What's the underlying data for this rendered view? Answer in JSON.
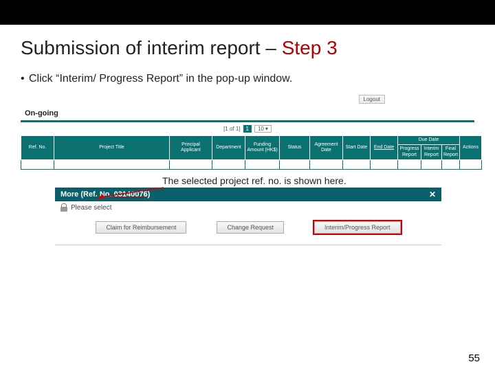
{
  "title_main": "Submission of interim report – ",
  "title_step": "Step 3",
  "bullet_text": "Click “Interim/ Progress Report” in the pop-up window.",
  "logout": "Logout",
  "ongoing": "On-going",
  "pager": {
    "label": "[1 of 1]",
    "current": "1",
    "size": "10"
  },
  "cols": {
    "ref": "Ref. No.",
    "title": "Project Title",
    "pa": "Principal Applicant",
    "dept": "Department",
    "amt": "Funding Amount (HK$)",
    "status": "Status",
    "agree": "Agreement Date",
    "start": "Start Date",
    "end": "End Date",
    "due": "Due Date",
    "prog": "Progress Report",
    "interim": "Interim Report",
    "final": "Final Report",
    "actions": "Actions"
  },
  "annotation": "The selected project ref. no. is shown here.",
  "popup": {
    "title_pre": "More (Ref. No. ",
    "refno": "03140076",
    "title_post": ")",
    "please": "Please select",
    "btn_claim": "Claim for Reimbursement",
    "btn_change": "Change Request",
    "btn_report": "Interim/Progress Report"
  },
  "page_number": "55"
}
